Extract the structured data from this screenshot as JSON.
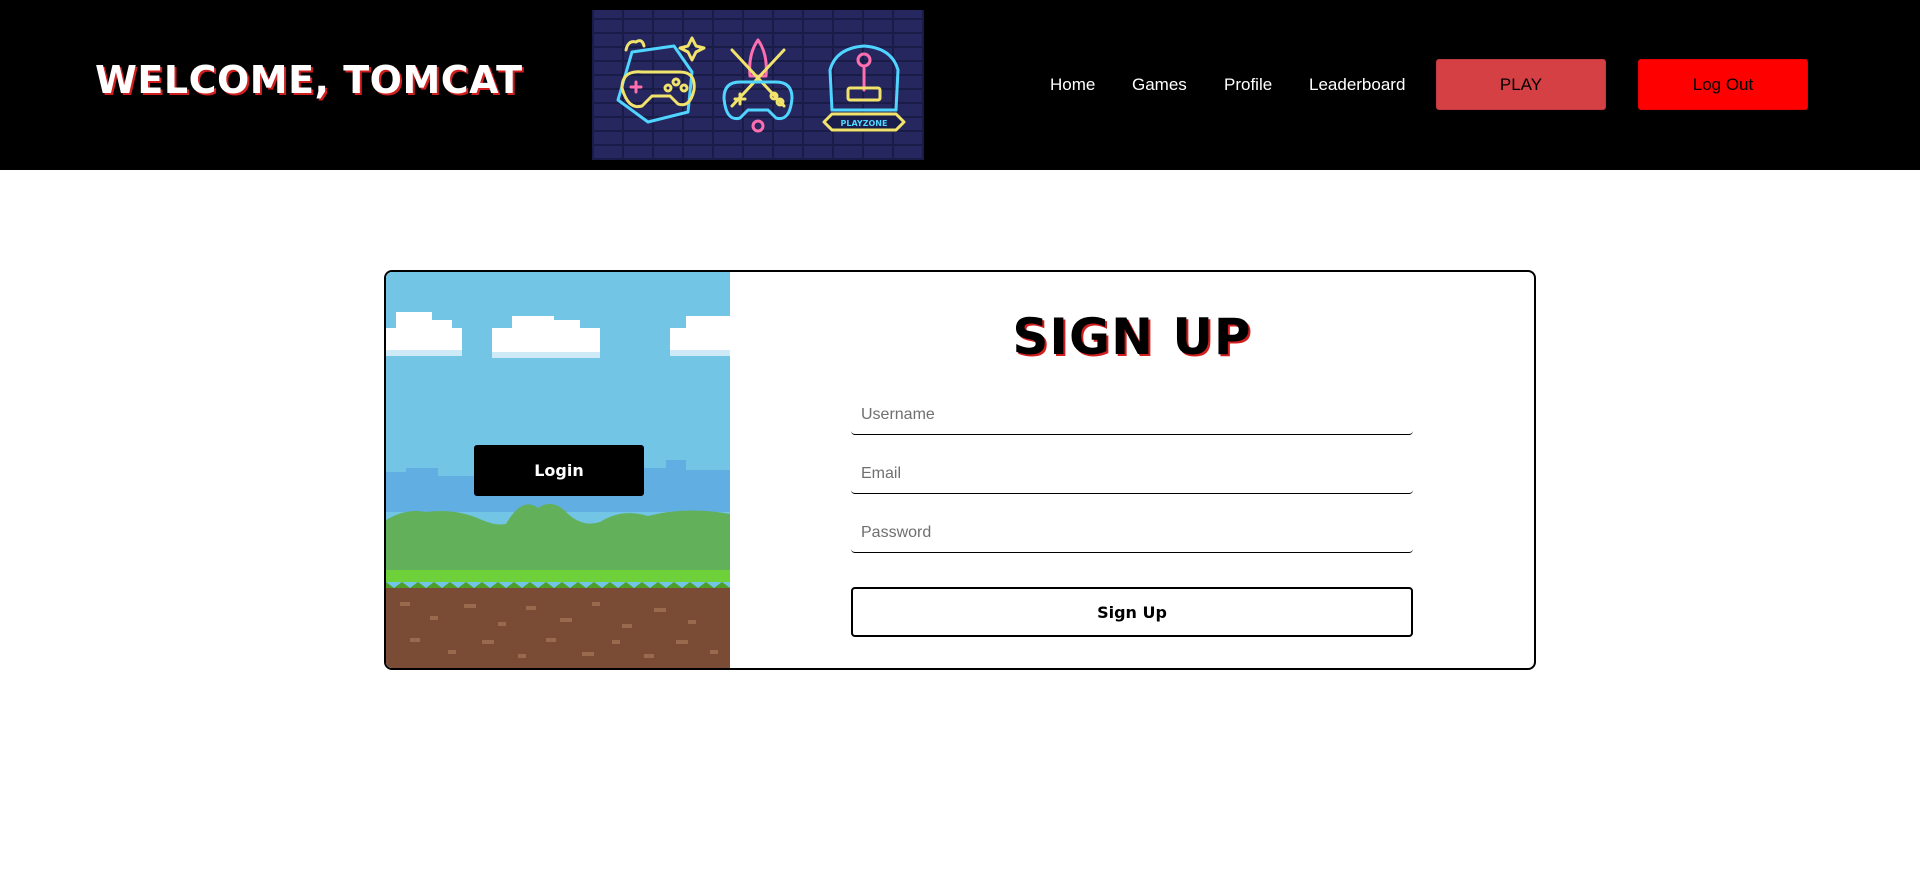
{
  "header": {
    "welcome_text": "WELCOME, TOMCAT",
    "banner_label": "PLAYZONE",
    "nav": {
      "home": "Home",
      "games": "Games",
      "profile": "Profile",
      "leaderboard": "Leaderboard"
    },
    "play_label": "PLAY",
    "logout_label": "Log Out"
  },
  "card": {
    "login_label": "Login",
    "title": "SIGN UP",
    "username_placeholder": "Username",
    "email_placeholder": "Email",
    "password_placeholder": "Password",
    "signup_label": "Sign Up"
  },
  "colors": {
    "header_bg": "#000000",
    "play_button": "#d54044",
    "logout_button": "#ff0000",
    "title_shadow": "#d11f1f",
    "sky": "#72c5e5",
    "grass": "#6fd13a",
    "dirt": "#7a4c36"
  },
  "icons": {
    "banner_left": "gamepad-icon",
    "banner_middle": "rocket-gamepad-icon",
    "banner_right": "joystick-icon"
  }
}
